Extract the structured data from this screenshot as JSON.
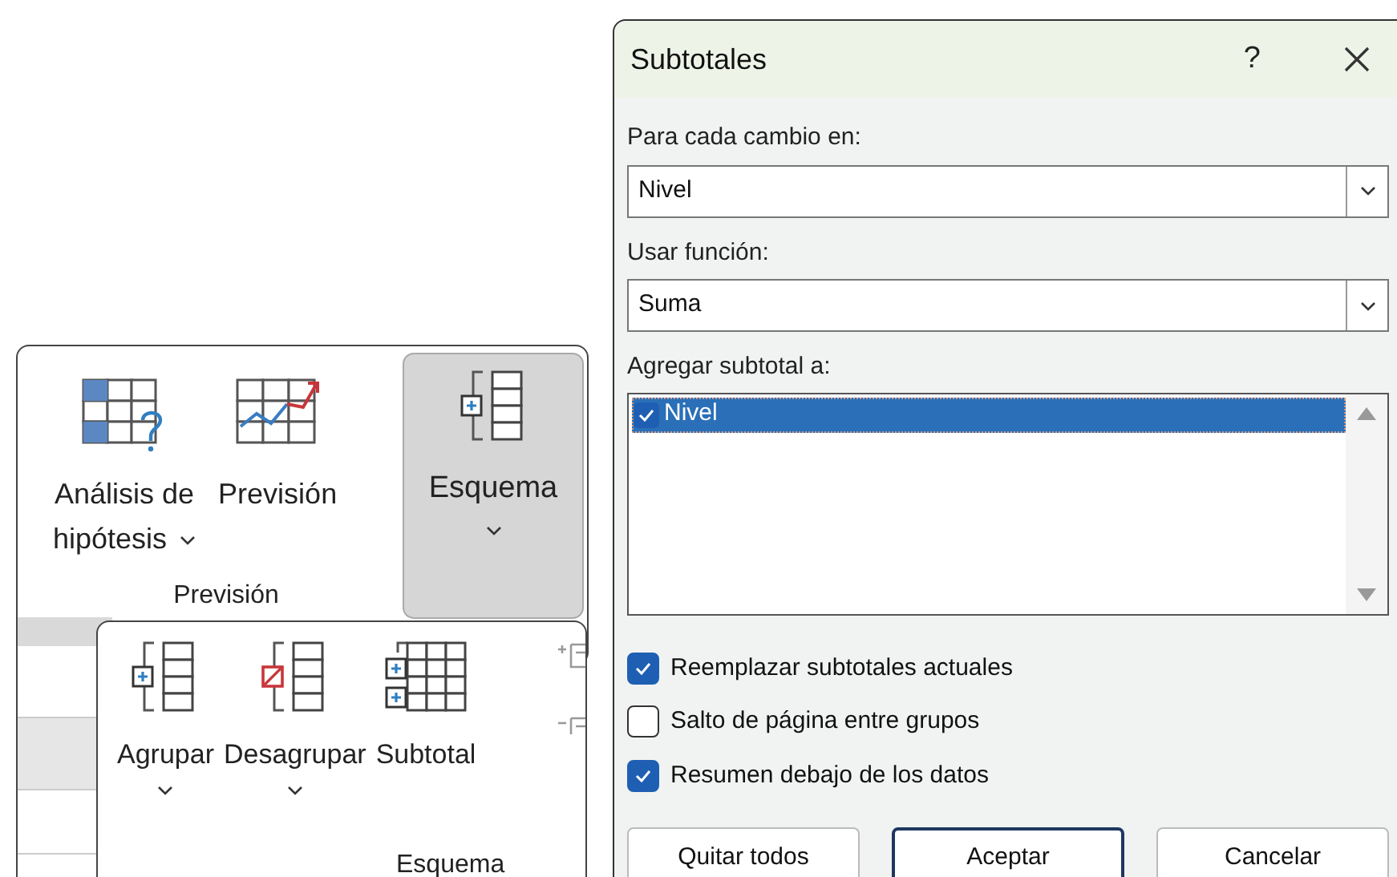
{
  "ribbon": {
    "buttons": [
      {
        "kind": "whatif",
        "lines": [
          "Análisis de",
          "hipótesis"
        ],
        "dropdown": true,
        "selected": false
      },
      {
        "kind": "forecast",
        "lines": [
          "Previsión"
        ],
        "dropdown": false,
        "selected": false
      },
      {
        "kind": "outline",
        "lines": [
          "Esquema"
        ],
        "dropdown": true,
        "selected": true
      }
    ],
    "group_label": "Previsión"
  },
  "flyout": {
    "buttons": [
      {
        "kind": "group",
        "label": "Agrupar",
        "dropdown": true
      },
      {
        "kind": "ungroup",
        "label": "Desagrupar",
        "dropdown": true
      },
      {
        "kind": "subtotal",
        "label": "Subtotal",
        "dropdown": false
      }
    ],
    "group_label": "Esquema"
  },
  "dialog": {
    "title": "Subtotales",
    "help": "?",
    "change_label": {
      "text": "Para cada cambio en:"
    },
    "change_value": "Nivel",
    "function_label": {
      "text": "Usar función:"
    },
    "function_value": "Suma",
    "add_label": {
      "text": "Agregar subtotal a:"
    },
    "add_items": [
      {
        "label": "Nivel",
        "checked": true,
        "selected": true
      }
    ],
    "options": [
      {
        "label": "Reemplazar subtotales actuales",
        "checked": true
      },
      {
        "label": "Salto de página entre grupos",
        "checked": false
      },
      {
        "label": "Resumen debajo de los datos",
        "checked": true
      }
    ],
    "buttons": [
      {
        "label": "Quitar todos",
        "default": false
      },
      {
        "label": "Aceptar",
        "default": true
      },
      {
        "label": "Cancelar",
        "default": false
      }
    ]
  }
}
